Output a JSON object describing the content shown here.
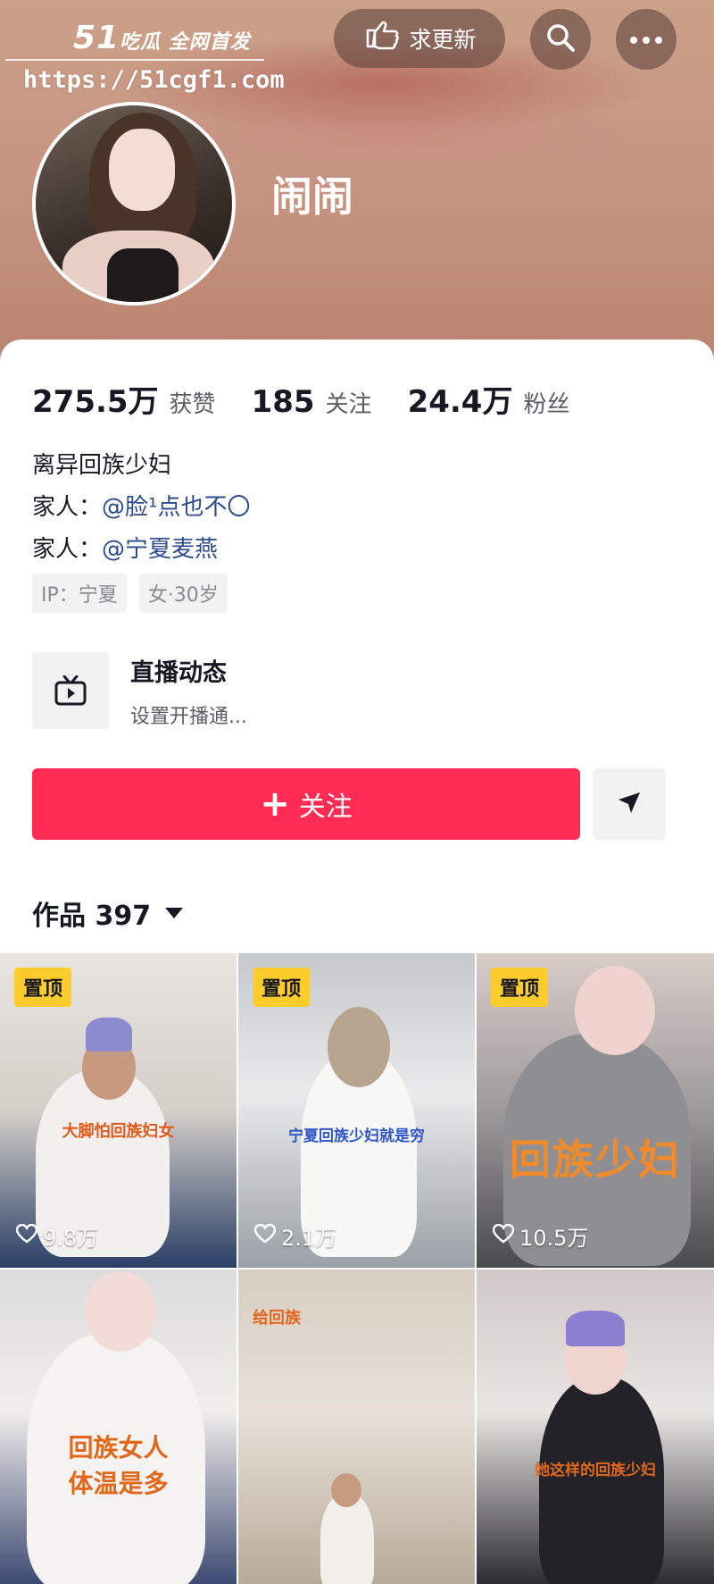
{
  "watermark": {
    "brand_num": "51",
    "brand_text": "吃瓜 全网首发",
    "url": "https://51cgf1.com"
  },
  "header": {
    "update_label": "求更新",
    "username": "闹闹"
  },
  "stats": [
    {
      "value": "275.5万",
      "label": "获赞"
    },
    {
      "value": "185",
      "label": "关注"
    },
    {
      "value": "24.4万",
      "label": "粉丝"
    }
  ],
  "bio": {
    "line1": "离异回族少妇",
    "line2_prefix": "家人：",
    "line2_mention": "@脸¹点也不〇",
    "line3_prefix": "家人：",
    "line3_mention": "@宁夏麦燕"
  },
  "tags": [
    "IP：宁夏",
    "女·30岁"
  ],
  "live": {
    "title": "直播动态",
    "subtitle": "设置开播通..."
  },
  "actions": {
    "follow_label": "关注"
  },
  "works": {
    "label": "作品 397"
  },
  "videos": [
    {
      "pinned": "置顶",
      "likes": "9.8万",
      "caption": "大脚怕回族妇女"
    },
    {
      "pinned": "置顶",
      "likes": "2.1万",
      "caption": "宁夏回族少妇就是穷"
    },
    {
      "pinned": "置顶",
      "likes": "10.5万",
      "caption": "回族少妇"
    },
    {
      "pinned": "",
      "likes": "",
      "caption": "回族女人\n体温是多"
    },
    {
      "pinned": "",
      "likes": "",
      "caption": "给回族"
    },
    {
      "pinned": "",
      "likes": "",
      "caption": "她这样的回族少妇"
    }
  ],
  "colors": {
    "accent": "#fe2c55",
    "pin": "#fccc2c",
    "mention": "#2d4a8a"
  }
}
